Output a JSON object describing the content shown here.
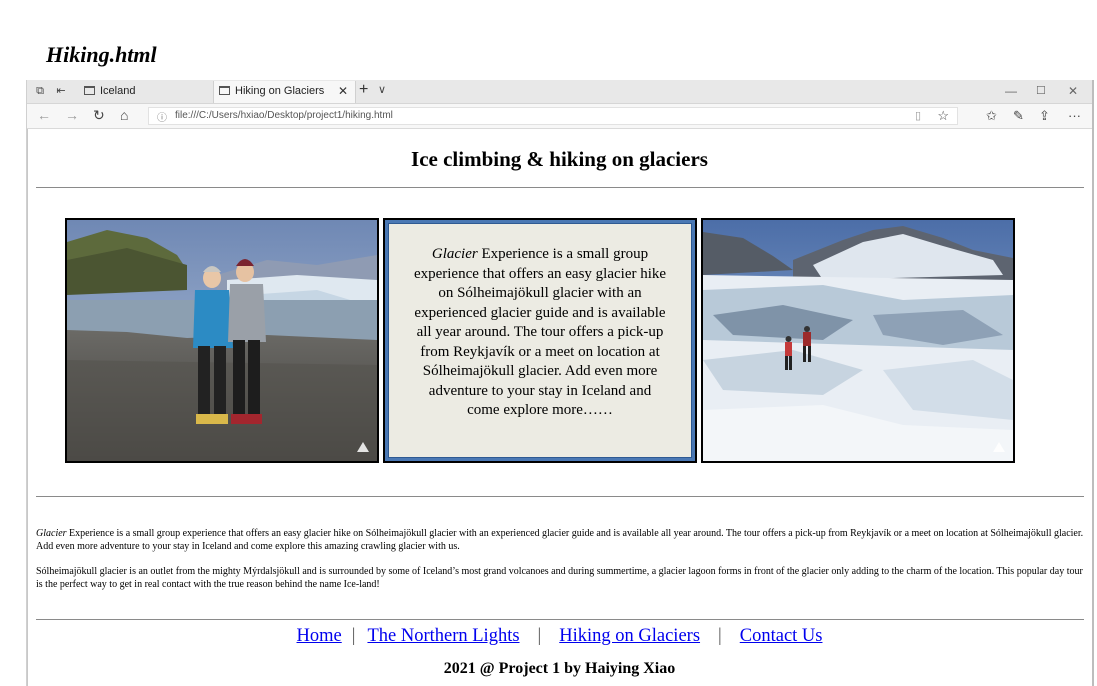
{
  "caption": "Hiking.html",
  "browser": {
    "tabs": [
      {
        "label": "Iceland",
        "active": false
      },
      {
        "label": "Hiking on Glaciers",
        "active": true
      }
    ],
    "url": "file:///C:/Users/hxiao/Desktop/project1/hiking.html"
  },
  "page": {
    "title": "Ice climbing & hiking on glaciers",
    "box": {
      "emphasis": "Glacier",
      "text": " Experience is a small group experience that offers an easy glacier hike on Sólheimajökull glacier with an experienced glacier guide and is available all year around. The tour offers a pick-up from Reykjavík or a meet on location at Sólheimajökull glacier. Add even more adventure to your stay in Iceland and come explore more……"
    },
    "paragraph1": {
      "emphasis": "Glacier",
      "text": " Experience is a small group experience that offers an easy glacier hike on Sólheimajökull glacier with an experienced glacier guide and is available all year around. The tour offers a pick-up from Reykjavík or a meet on location at Sólheimajökull glacier. Add even more adventure to your stay in Iceland and come explore this amazing crawling glacier with us."
    },
    "paragraph2": "Sólheimajökull glacier is an outlet from the mighty Mýrdalsjökull and is surrounded by some of Iceland’s most grand volcanoes and during summertime, a glacier lagoon forms in front of the glacier only adding to the charm of the location. This popular day tour is the perfect way to get in real contact with the true reason behind the name Ice-land!",
    "nav": {
      "home": "Home",
      "lights": "The Northern Lights",
      "hiking": "Hiking on Glaciers",
      "contact": "Contact Us",
      "separator": "|"
    },
    "copyright": "2021 @ Project 1 by Haiying Xiao"
  }
}
